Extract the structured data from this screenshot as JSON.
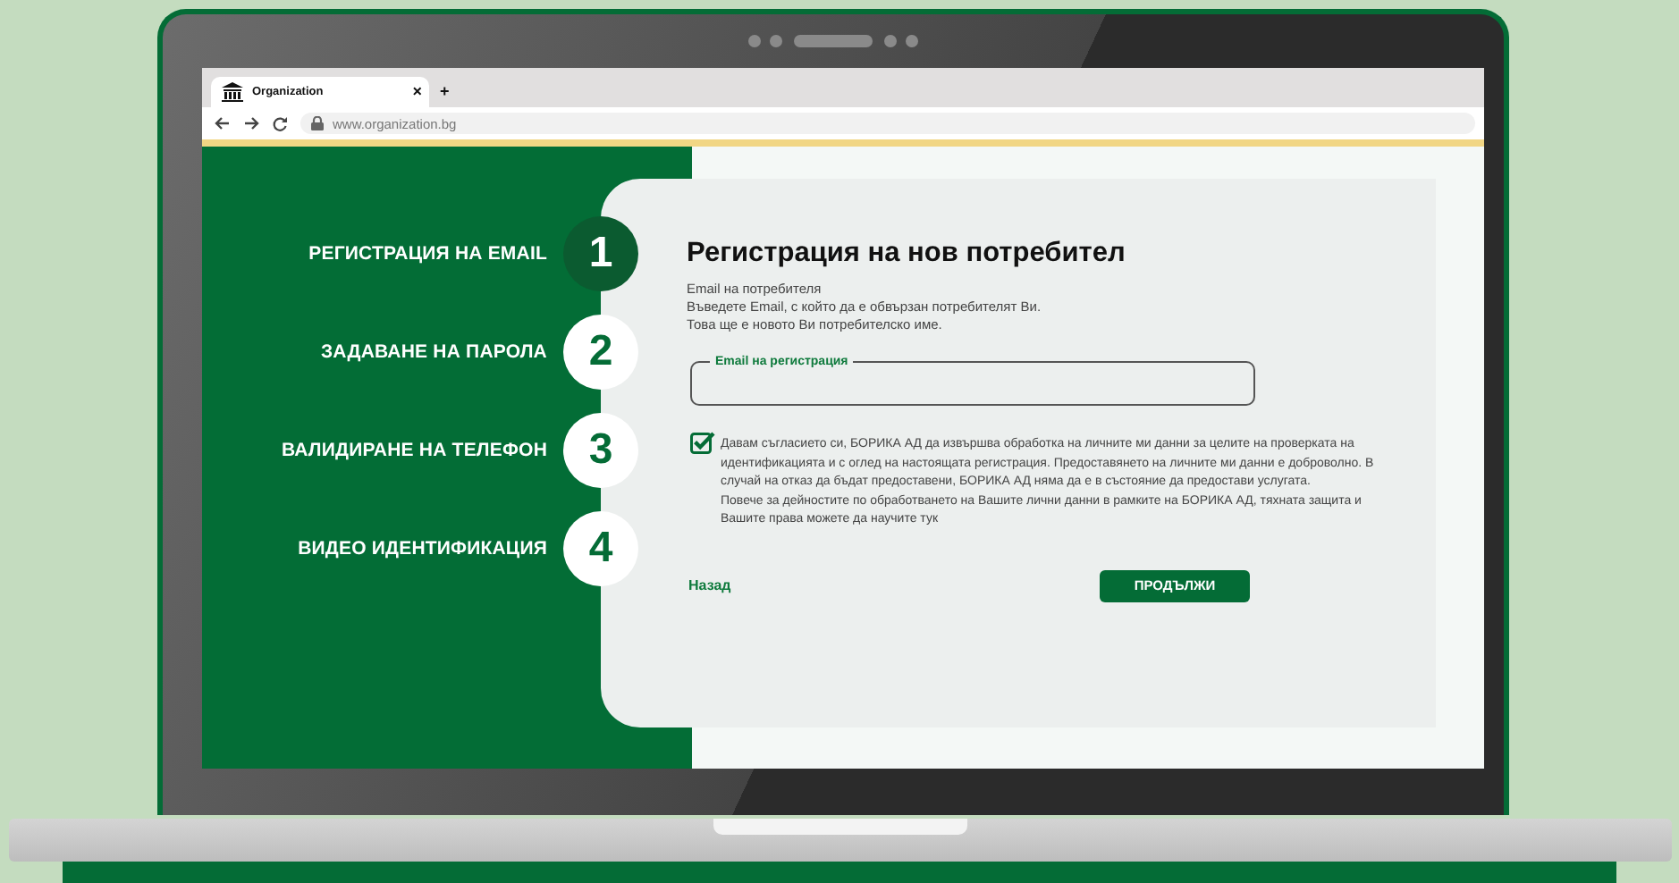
{
  "browser": {
    "tab": {
      "title": "Organization",
      "close": "×"
    },
    "new_tab": "+",
    "url": "www.organization.bg"
  },
  "steps": [
    {
      "number": "1",
      "label": "РЕГИСТРАЦИЯ НА EMAIL",
      "selected": true
    },
    {
      "number": "2",
      "label": "ЗАДАВАНЕ НА ПАРОЛА",
      "selected": false
    },
    {
      "number": "3",
      "label": "ВАЛИДИРАНЕ НА ТЕЛЕФОН",
      "selected": false
    },
    {
      "number": "4",
      "label": "ВИДЕО ИДЕНТИФИКАЦИЯ",
      "selected": false
    }
  ],
  "form": {
    "title": "Регистрация на нов потребител",
    "description": [
      "Email на потребителя",
      "Въведете Email, с който да е обвързан потребителят Ви.",
      "Това ще е новото Ви потребителско име."
    ],
    "email_field": {
      "label": "Email на регистрация"
    },
    "consent": {
      "checked": true,
      "paragraphs": [
        "Давам съгласието си, БОРИКА АД да извършва обработка на личните ми данни за целите на проверката на идентификацията и с оглед на настоящата регистрация. Предоставянето на личните ми данни е доброволно. В случай на отказ да бъдат предоставени, БОРИКА АД няма да е в състояние да предостави услугата.",
        "Повече за дейностите по обработването на Вашите лични данни в рамките на БОРИКА АД, тяхната защита и Вашите права можете да научите тук"
      ]
    },
    "back_link": "Назад",
    "continue_button": "ПРОДЪЛЖИ"
  }
}
